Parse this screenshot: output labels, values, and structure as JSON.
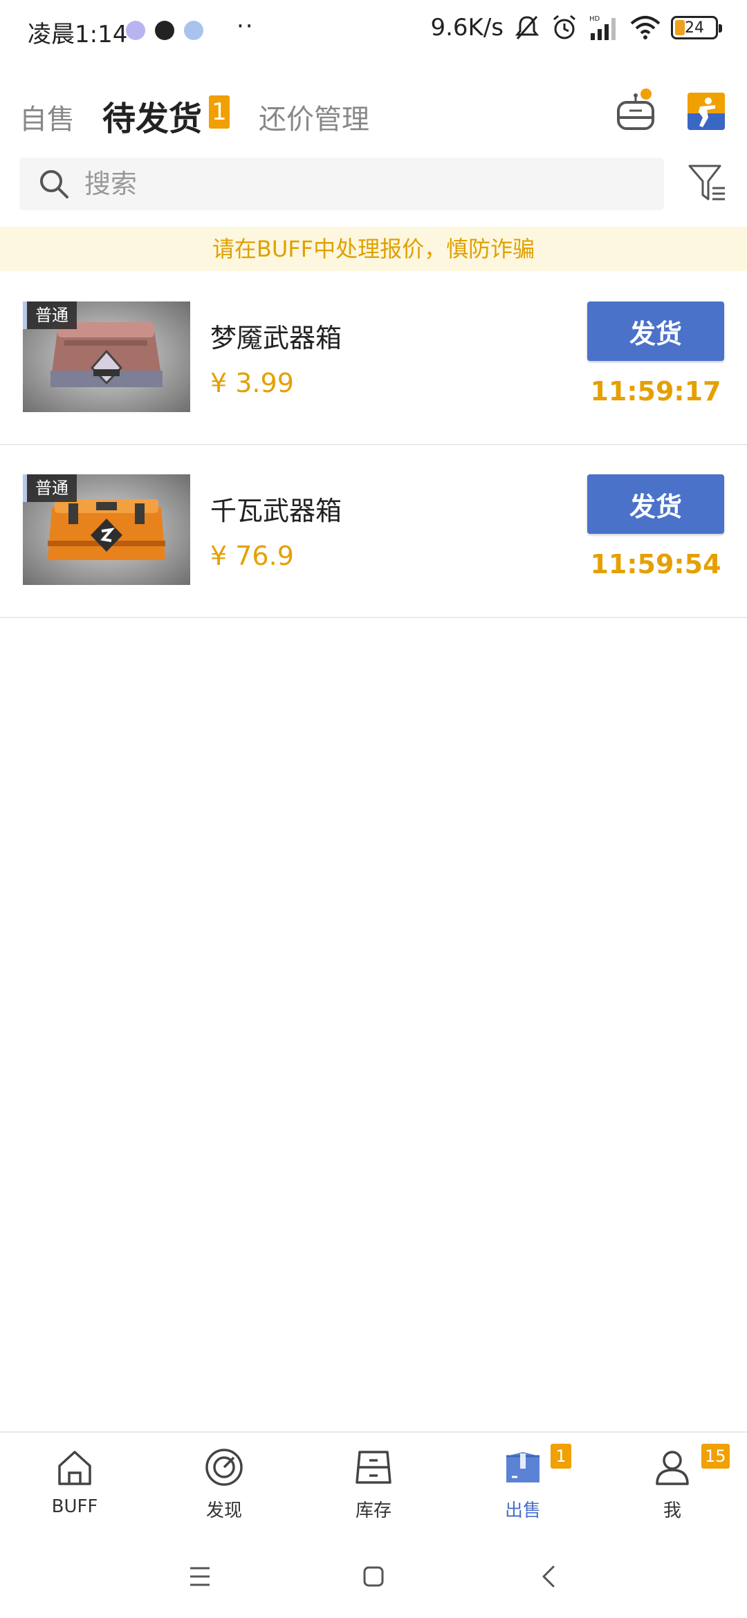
{
  "status_bar": {
    "time": "凌晨1:14",
    "more": "··",
    "net_speed": "9.6K/s",
    "battery": "24"
  },
  "tabs": [
    {
      "label": "自售",
      "active": false
    },
    {
      "label": "待发货",
      "active": true,
      "badge": "1"
    },
    {
      "label": "还价管理",
      "active": false
    }
  ],
  "header_icons": [
    "robot-icon",
    "cs-game-icon"
  ],
  "search": {
    "placeholder": "搜索",
    "value": ""
  },
  "notice": "请在BUFF中处理报价，慎防诈骗",
  "items": [
    {
      "tag": "普通",
      "name": "梦魇武器箱",
      "price": "¥ 3.99",
      "button": "发货",
      "countdown": "11:59:17",
      "thumb_color": "#b07a70"
    },
    {
      "tag": "普通",
      "name": "千瓦武器箱",
      "price": "¥ 76.9",
      "button": "发货",
      "countdown": "11:59:54",
      "thumb_color": "#e88a20"
    }
  ],
  "bottom_nav": [
    {
      "label": "BUFF",
      "icon": "home-icon",
      "active": false
    },
    {
      "label": "发现",
      "icon": "compass-icon",
      "active": false
    },
    {
      "label": "库存",
      "icon": "inventory-icon",
      "active": false
    },
    {
      "label": "出售",
      "icon": "sell-box-icon",
      "active": true,
      "badge": "1"
    },
    {
      "label": "我",
      "icon": "user-icon",
      "active": false,
      "badge": "15"
    }
  ],
  "colors": {
    "accent_blue": "#4a72c9",
    "accent_orange": "#f0a000",
    "notice_bg": "#fdf7e0"
  }
}
